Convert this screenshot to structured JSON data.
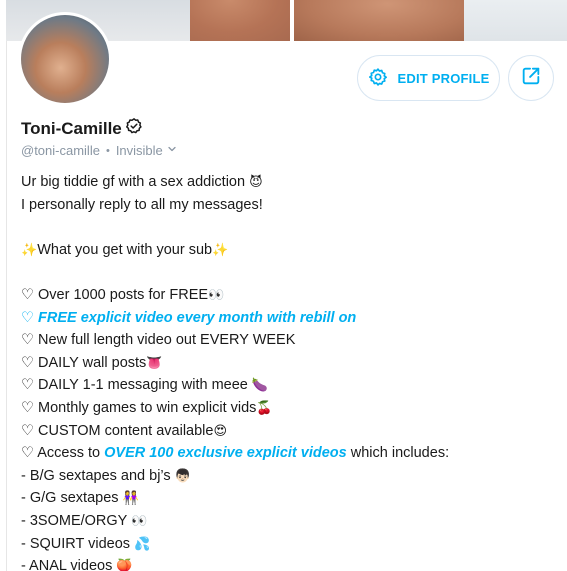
{
  "profile": {
    "name": "Toni-Camille",
    "handle": "@toni-camille",
    "separator": "•",
    "status": "Invisible"
  },
  "actions": {
    "edit_label": "EDIT PROFILE"
  },
  "colors": {
    "accent": "#00aff0",
    "muted": "#8a96a3",
    "text": "#1a1a1a"
  },
  "icons": {
    "verified": "verified-badge-icon",
    "settings": "gear-icon",
    "share": "share-icon",
    "dropdown": "chevron-down-icon"
  },
  "bio": [
    {
      "parts": [
        {
          "t": "Ur big tiddie gf with a sex addiction "
        },
        {
          "t": "😈",
          "emoji": true
        }
      ]
    },
    {
      "parts": [
        {
          "t": "I personally reply to all my messages!"
        }
      ]
    },
    {
      "blank": true
    },
    {
      "parts": [
        {
          "t": "✨",
          "emoji": true
        },
        {
          "t": "What you get with your sub"
        },
        {
          "t": "✨",
          "emoji": true
        }
      ]
    },
    {
      "blank": true
    },
    {
      "parts": [
        {
          "t": "♡ Over 1000 posts for FREE"
        },
        {
          "t": "👀",
          "emoji": true
        }
      ]
    },
    {
      "parts": [
        {
          "t": "♡ ",
          "accentPlain": true
        },
        {
          "t": "FREE explicit video every month with rebill on",
          "hl": true
        }
      ]
    },
    {
      "parts": [
        {
          "t": "♡ New full length video out EVERY WEEK"
        }
      ]
    },
    {
      "parts": [
        {
          "t": "♡ DAILY wall posts"
        },
        {
          "t": "👅",
          "emoji": true
        }
      ]
    },
    {
      "parts": [
        {
          "t": "♡ DAILY 1-1 messaging with meee "
        },
        {
          "t": "🍆",
          "emoji": true
        }
      ]
    },
    {
      "parts": [
        {
          "t": "♡ Monthly games to win explicit vids"
        },
        {
          "t": "🍒",
          "emoji": true
        }
      ]
    },
    {
      "parts": [
        {
          "t": "♡ CUSTOM content available"
        },
        {
          "t": "😍",
          "emoji": true
        }
      ]
    },
    {
      "parts": [
        {
          "t": "♡ Access to "
        },
        {
          "t": "OVER 100 exclusive explicit videos",
          "hl": true
        },
        {
          "t": " which includes:"
        }
      ]
    },
    {
      "parts": [
        {
          "t": "- B/G sextapes and bj’s "
        },
        {
          "t": "👦🏻",
          "emoji": true
        }
      ]
    },
    {
      "parts": [
        {
          "t": "- G/G sextapes "
        },
        {
          "t": "👭",
          "emoji": true
        }
      ]
    },
    {
      "parts": [
        {
          "t": "- 3SOME/ORGY "
        },
        {
          "t": "👀",
          "emoji": true
        }
      ]
    },
    {
      "parts": [
        {
          "t": "- SQUIRT videos "
        },
        {
          "t": "💦",
          "emoji": true
        }
      ]
    },
    {
      "parts": [
        {
          "t": "- ANAL videos "
        },
        {
          "t": "🍑",
          "emoji": true
        }
      ]
    }
  ]
}
